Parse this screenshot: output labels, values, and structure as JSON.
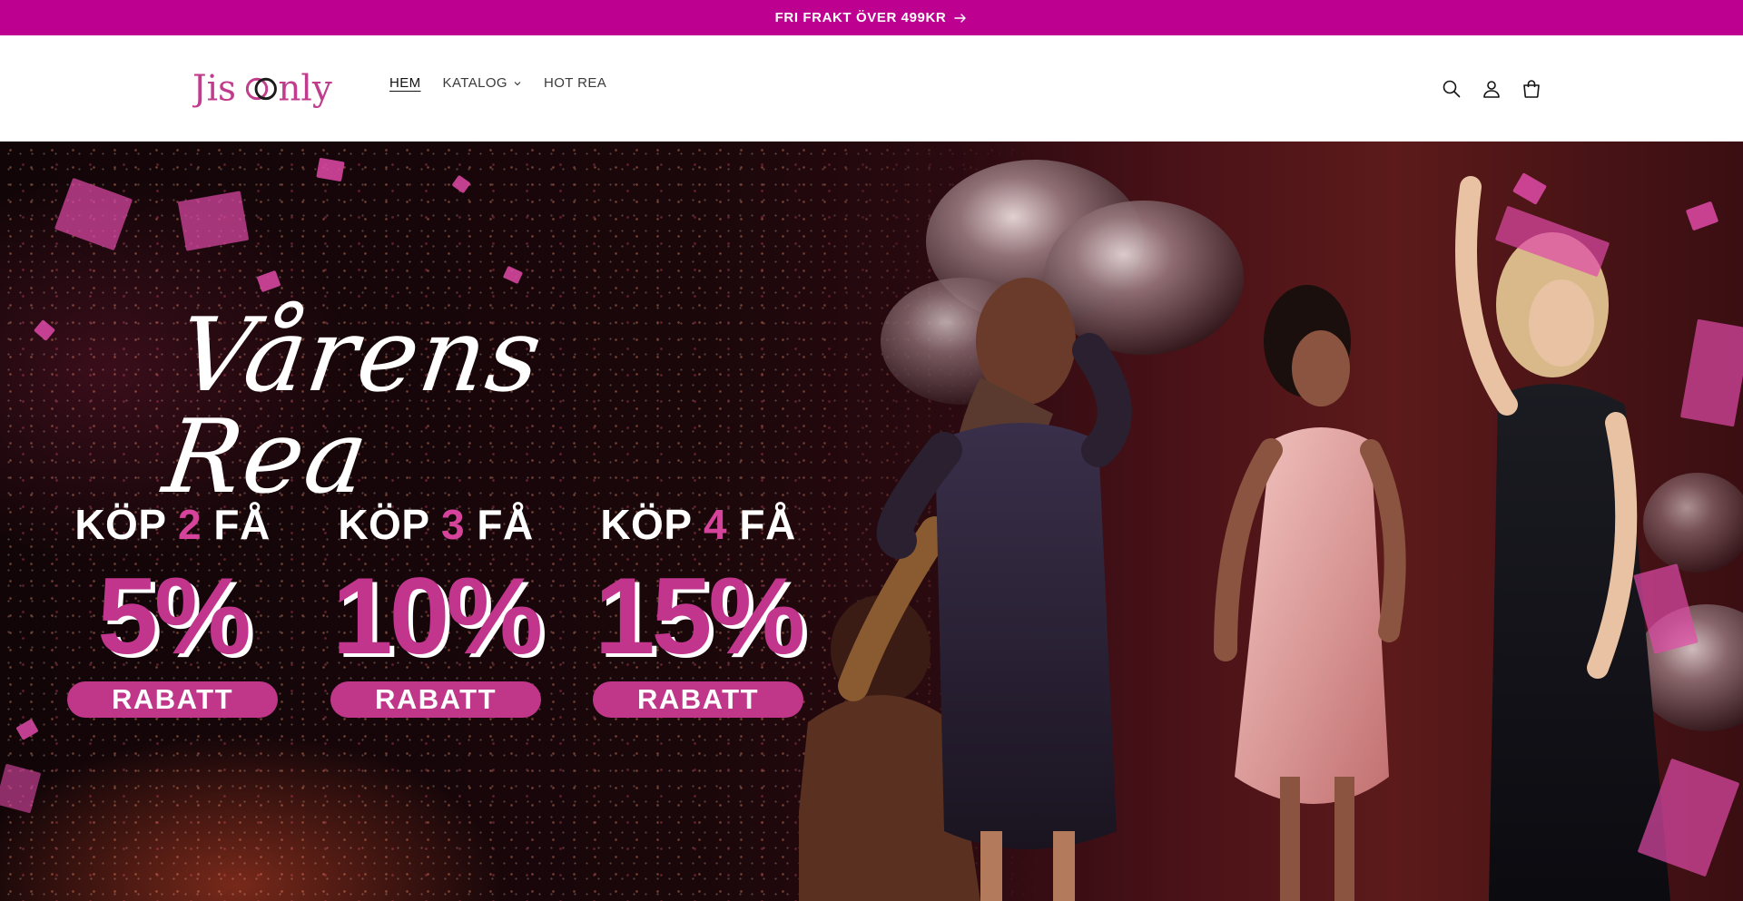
{
  "announcement": {
    "text": "FRI FRAKT ÖVER 499KR"
  },
  "header": {
    "logo_text": "Jisoonly",
    "nav": [
      {
        "label": "HEM",
        "active": true
      },
      {
        "label": "KATALOG",
        "has_dropdown": true
      },
      {
        "label": "HOT REA"
      }
    ],
    "icons": [
      "search-icon",
      "account-icon",
      "cart-icon"
    ]
  },
  "hero": {
    "title": "Vårens Rea",
    "offers": [
      {
        "prefix": "KÖP",
        "number": "2",
        "suffix": "FÅ",
        "discount": "5%",
        "label": "RABATT"
      },
      {
        "prefix": "KÖP",
        "number": "3",
        "suffix": "FÅ",
        "discount": "10%",
        "label": "RABATT"
      },
      {
        "prefix": "KÖP",
        "number": "4",
        "suffix": "FÅ",
        "discount": "15%",
        "label": "RABATT"
      }
    ]
  },
  "colors": {
    "brand": "#bd0090",
    "accent_pink": "#c2358d",
    "text_dark": "#121212"
  }
}
